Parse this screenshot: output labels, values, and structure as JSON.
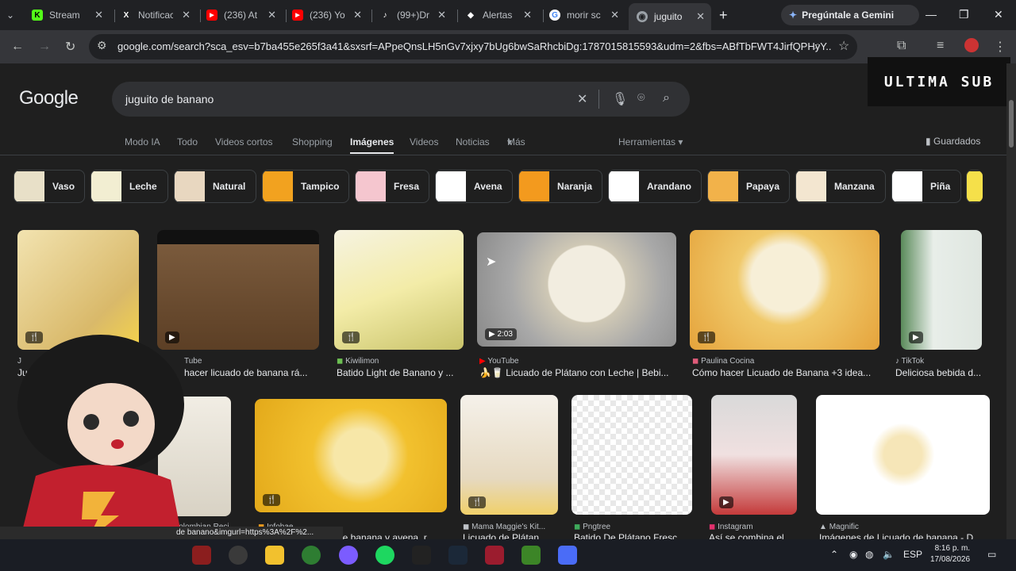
{
  "tabs": [
    {
      "title": "Stream",
      "icon": "kick-icon",
      "color": "#53fc18"
    },
    {
      "title": "Notificaciones",
      "icon": "x-icon",
      "color": "#000000"
    },
    {
      "title": "(236) At",
      "icon": "youtube-icon",
      "color": "#ff0000"
    },
    {
      "title": "(236) Yo",
      "icon": "youtube-icon",
      "color": "#ff0000"
    },
    {
      "title": "(99+)Dr",
      "icon": "tiktok-icon",
      "color": "#000000"
    },
    {
      "title": "Alertas",
      "icon": "alert-icon",
      "color": "#ffffff"
    },
    {
      "title": "morir sc",
      "icon": "google-icon",
      "color": "#4285f4"
    },
    {
      "title": "juguito",
      "icon": "globe-icon",
      "color": "#9aa0a6"
    }
  ],
  "gemini_label": "Pregúntale a Gemini",
  "url": "google.com/search?sca_esv=b7ba455e265f3a41&sxsrf=APpeQnsLH5nGv7xjxy7bUg6bwSaRhcbiDg:1787015815593&udm=2&fbs=ABfTbFWT4JirfQPHyY...",
  "overlay_text": "ULTIMA SUB",
  "logo": "Google",
  "query": "juguito de banano",
  "nav": [
    "Modo IA",
    "Todo",
    "Videos cortos",
    "Shopping",
    "Imágenes",
    "Videos",
    "Noticias",
    "Más"
  ],
  "tools_label": "Herramientas",
  "saved_label": "Guardados",
  "chips": [
    {
      "label": "Vaso",
      "color": "#e8e0c8"
    },
    {
      "label": "Leche",
      "color": "#f2eed2"
    },
    {
      "label": "Natural",
      "color": "#e8d7c0"
    },
    {
      "label": "Tampico",
      "color": "#f2a21f"
    },
    {
      "label": "Fresa",
      "color": "#f5c6cf"
    },
    {
      "label": "Avena",
      "color": "#ffffff"
    },
    {
      "label": "Naranja",
      "color": "#f39a1e"
    },
    {
      "label": "Arandano",
      "color": "#ffffff"
    },
    {
      "label": "Papaya",
      "color": "#f2b24a"
    },
    {
      "label": "Manzana",
      "color": "#f3e6d0"
    },
    {
      "label": "Piña",
      "color": "#ffffff"
    }
  ],
  "results": [
    {
      "source": "J",
      "title": "Ju",
      "badge": "",
      "color": "#e9d8a6"
    },
    {
      "source": "Tube",
      "title": "hacer licuado de banana rá...",
      "badge": "",
      "color": "#6b4f35"
    },
    {
      "source": "Kiwilimon",
      "title": "Batido Light de Banano y ...",
      "badge": "",
      "color": "#f3ecb8"
    },
    {
      "source": "YouTube",
      "title": "🍌🥛 Licuado de Plátano con Leche | Bebi...",
      "badge": "▶ 2:03",
      "color": "#d9d4c3"
    },
    {
      "source": "Paulina Cocina",
      "title": "Cómo hacer Licuado de Banana +3 idea...",
      "badge": "",
      "color": "#f0c96a"
    },
    {
      "source": "TikTok",
      "title": "Deliciosa bebida d...",
      "badge": "",
      "color": "#dfe6e0"
    },
    {
      "source": "Infobae",
      "title": "de banana y avena. r...",
      "badge": "",
      "color": "#f2c12e"
    },
    {
      "source": "Mama Maggie's Kit...",
      "title": "Licuado de Plátan...",
      "badge": "",
      "color": "#f0ebe2"
    },
    {
      "source": "Pngtree",
      "title": "Batido De Plátano Fresc...",
      "badge": "",
      "color": "#f5ec9c"
    },
    {
      "source": "Instagram",
      "title": "Así se combina el ...",
      "badge": "",
      "color": "#e9d4d4"
    },
    {
      "source": "Magnific",
      "title": "Imágenes de Licuado de banana - D...",
      "badge": "",
      "color": "#faf3e2"
    },
    {
      "source": "Colombian Reci",
      "title": "",
      "badge": "",
      "color": "#e7e2d6"
    }
  ],
  "status_url": "de banano&imgurl=https%3A%2F%2...",
  "tray": {
    "lang": "ESP",
    "time": "8:16 p. m.",
    "date": "17/08/2026"
  }
}
